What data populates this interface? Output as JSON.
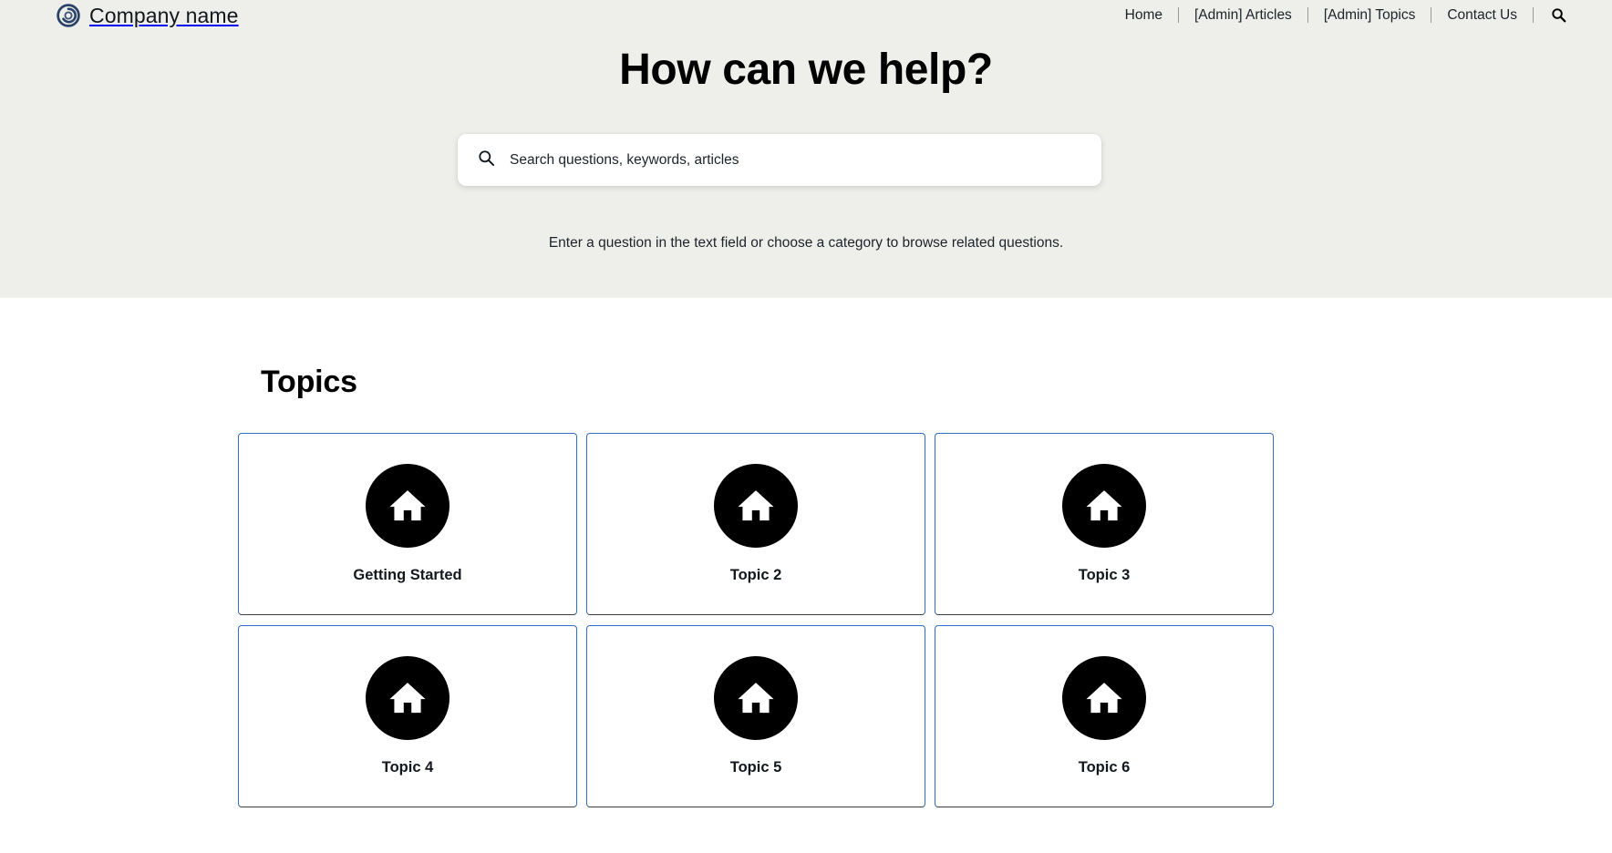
{
  "header": {
    "brand": {
      "logo_icon": "swirl-circle-logo",
      "logo_color": "#2b4368",
      "name": "Company name"
    },
    "nav_items": [
      {
        "label": "Home"
      },
      {
        "label": "[Admin] Articles"
      },
      {
        "label": "[Admin] Topics"
      },
      {
        "label": "Contact Us"
      }
    ],
    "search_icon": "search-icon"
  },
  "hero": {
    "title": "How can we help?",
    "subtitle": "Enter a question in the text field or choose a category to browse related questions.",
    "background_color": "#eeeeea",
    "search": {
      "icon": "search-icon",
      "placeholder": "Search questions, keywords, articles",
      "value": ""
    }
  },
  "topics": {
    "heading": "Topics",
    "card_border_color": "#2f6fc4",
    "icon_background": "#000000",
    "cards": [
      {
        "icon": "home-icon",
        "label": "Getting Started"
      },
      {
        "icon": "home-icon",
        "label": "Topic 2"
      },
      {
        "icon": "home-icon",
        "label": "Topic 3"
      },
      {
        "icon": "home-icon",
        "label": "Topic 4"
      },
      {
        "icon": "home-icon",
        "label": "Topic 5"
      },
      {
        "icon": "home-icon",
        "label": "Topic 6"
      }
    ]
  }
}
